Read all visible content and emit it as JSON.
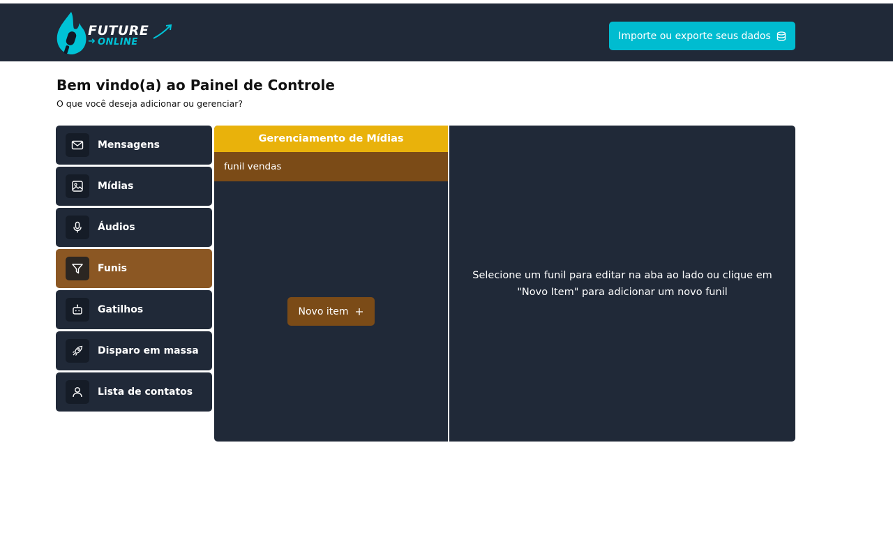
{
  "header": {
    "logo": {
      "line1": "FUTURE",
      "line2": "ONLINE"
    },
    "io_button_label": "Importe ou exporte seus dados",
    "io_button_icon": "database-icon",
    "background": "#202938",
    "accent": "#00bcd0"
  },
  "page": {
    "title": "Bem vindo(a) ao Painel de Controle",
    "subtitle": "O que você deseja adicionar ou gerenciar?"
  },
  "sidebar": {
    "items": [
      {
        "label": "Mensagens",
        "icon": "mail-icon",
        "active": false
      },
      {
        "label": "Mídias",
        "icon": "image-icon",
        "active": false
      },
      {
        "label": "Áudios",
        "icon": "microphone-icon",
        "active": false
      },
      {
        "label": "Funis",
        "icon": "filter-icon",
        "active": true
      },
      {
        "label": "Gatilhos",
        "icon": "robot-icon",
        "active": false
      },
      {
        "label": "Disparo em massa",
        "icon": "rocket-icon",
        "active": false
      },
      {
        "label": "Lista de contatos",
        "icon": "user-icon",
        "active": false
      }
    ],
    "active_color": "#8b5723"
  },
  "media_panel": {
    "heading": "Gerenciamento de Mídias",
    "items": [
      "funil vendas"
    ],
    "new_button_label": "Novo item",
    "heading_color": "#e9b20b",
    "selected_color": "#7b4b17"
  },
  "detail_panel": {
    "message": "Selecione um funil para editar na aba ao lado ou clique em \"Novo Item\" para adicionar um novo funil"
  }
}
